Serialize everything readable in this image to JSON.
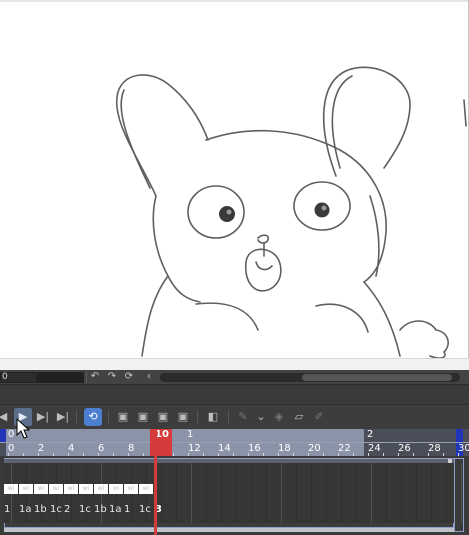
{
  "statusbar": {
    "zoom_value": "0",
    "icons": [
      "rotate-left-icon",
      "rotate-right-icon",
      "reset-rotation-icon",
      "collapse-left-icon"
    ]
  },
  "toolbar": {
    "buttons": [
      "first-frame-icon",
      "play-icon",
      "next-frame-icon",
      "last-frame-icon",
      "loop-icon",
      "new-animation-cel-icon",
      "new-cel-before-icon",
      "new-cel-after-icon",
      "delete-cel-icon",
      "onion-skin-icon",
      "assign-cel-icon",
      "dropdown-icon",
      "cel-settings-icon",
      "camera-icon",
      "edit-cel-icon"
    ]
  },
  "timeline": {
    "current_frame": "10",
    "ruler_top": [
      {
        "text": "0"
      },
      {
        "text": "1"
      },
      {
        "text": "2"
      }
    ],
    "ruler_bottom": [
      "0",
      "2",
      "4",
      "6",
      "8",
      "10",
      "12",
      "14",
      "16",
      "18",
      "20",
      "22",
      "24",
      "26",
      "28",
      "30"
    ],
    "cel_labels": [
      "1",
      "1a",
      "1b",
      "1c",
      "2",
      "1c",
      "1b",
      "1a",
      "1",
      "1c",
      "3"
    ],
    "cel_marks": [
      "wi",
      "wi",
      "wi",
      "wi",
      "wi",
      "wi",
      "wi",
      "wi",
      "wi",
      "wi"
    ]
  },
  "colors": {
    "accent": "#4c7fd0",
    "playhead": "#d63b3b",
    "range_marker": "#2035b8"
  }
}
